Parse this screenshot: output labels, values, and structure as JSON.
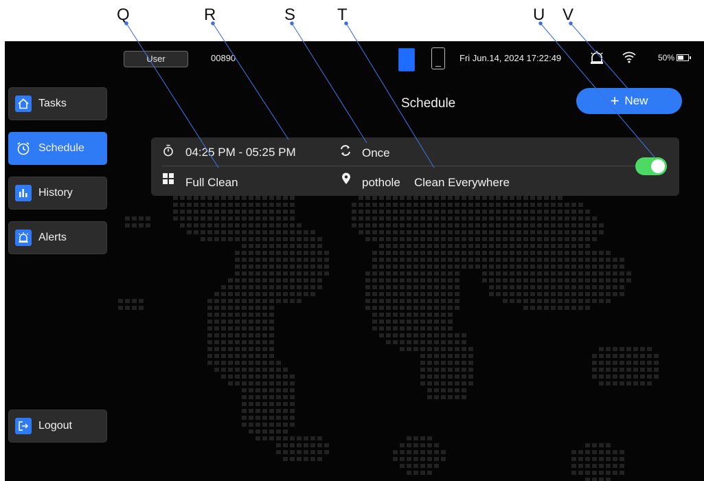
{
  "annotations": [
    "Q",
    "R",
    "S",
    "T",
    "U",
    "V"
  ],
  "status_bar": {
    "user_label": "User",
    "user_id": "00890",
    "datetime": "Fri Jun.14, 2024 17:22:49",
    "battery_percent": "50%"
  },
  "sidebar": {
    "items": [
      {
        "label": "Tasks",
        "icon": "home-icon"
      },
      {
        "label": "Schedule",
        "icon": "clock-icon"
      },
      {
        "label": "History",
        "icon": "bar-chart-icon"
      },
      {
        "label": "Alerts",
        "icon": "alarm-icon"
      }
    ],
    "logout_label": "Logout",
    "active_color": "#2f7bf5"
  },
  "header": {
    "title": "Schedule",
    "new_label": "New"
  },
  "schedule": {
    "time_range": "04:25 PM - 05:25 PM",
    "repeat": "Once",
    "mode": "Full Clean",
    "location": "pothole",
    "area": "Clean Everywhere",
    "enabled": true,
    "toggle_color": "#4cd964"
  }
}
